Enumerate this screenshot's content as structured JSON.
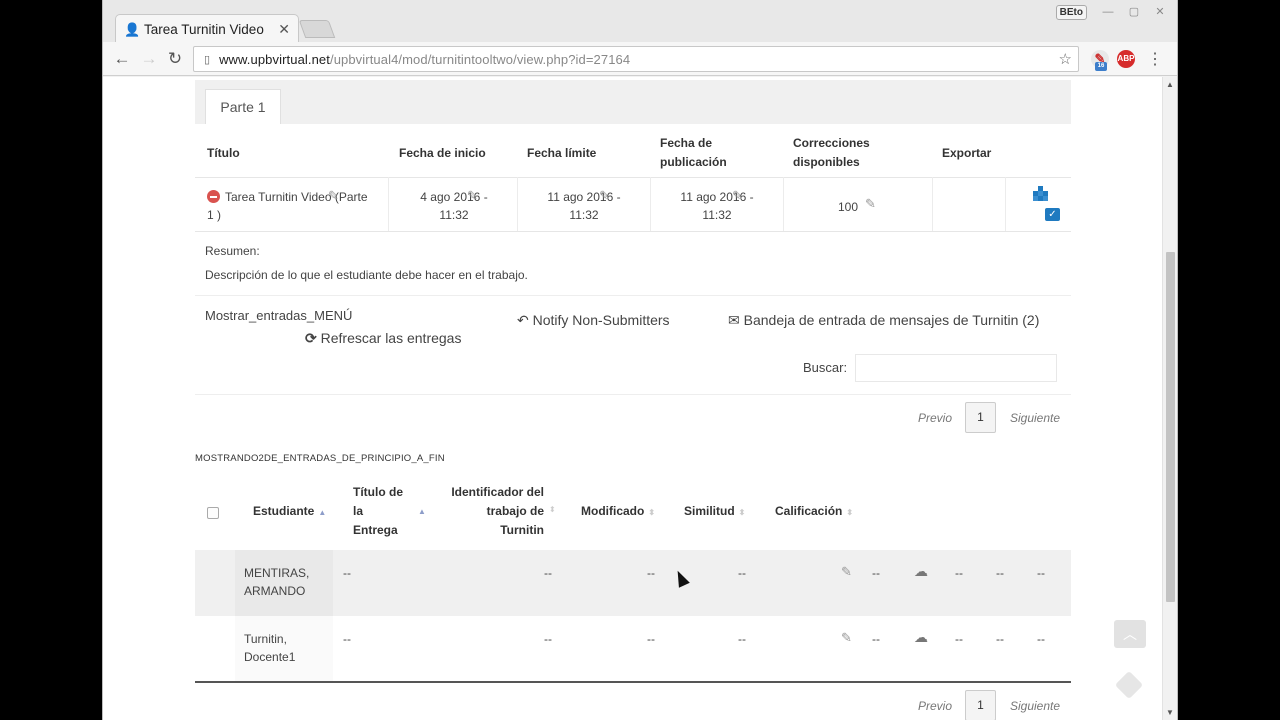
{
  "browser": {
    "tab_title": "Tarea Turnitin Video",
    "tab_close": "✕",
    "profile_badge": "BEto",
    "url_host": "www.upbvirtual.net",
    "url_path": "/upbvirtual4/mod/turnitintooltwo/view.php?id=27164",
    "ext_abp": "ABP",
    "ext_count": "16"
  },
  "parts": {
    "tab_label": "Parte 1"
  },
  "assignment": {
    "headers": {
      "title": "Título",
      "start": "Fecha de inicio",
      "due": "Fecha límite",
      "post_line1": "Fecha de",
      "post_line2": "publicación",
      "marks_line1": "Correcciones",
      "marks_line2": "disponibles",
      "export": "Exportar"
    },
    "row": {
      "title_line1": "Tarea Turnitin Video (Parte",
      "title_line2": "1      )",
      "start_line1": "4 ago 2016 -",
      "start_line2": "11:32",
      "due_line1": "11 ago 2016 -",
      "due_line2": "11:32",
      "post_line1": "11 ago 2016 -",
      "post_line2": "11:32",
      "marks": "100"
    },
    "summary_label": "Resumen:",
    "summary_text": "Descripción de lo que el estudiante debe hacer en el trabajo."
  },
  "controls": {
    "show_entries": "Mostrar_entradas_MENÚ",
    "refresh": "Refrescar las entregas",
    "notify": "Notify Non-Submitters",
    "inbox": "Bandeja de entrada de mensajes de Turnitin (2)",
    "search_label": "Buscar:"
  },
  "pagination": {
    "prev": "Previo",
    "page": "1",
    "next": "Siguiente"
  },
  "showing_text": "MOSTRANDO2DE_ENTRADAS_DE_PRINCIPIO_A_FIN",
  "submissions": {
    "headers": {
      "student": "Estudiante",
      "title_l1": "Título de",
      "title_l2": "la",
      "title_l3": "Entrega",
      "id_l1": "Identificador del",
      "id_l2": "trabajo de",
      "id_l3": "Turnitin",
      "modified": "Modificado",
      "similarity": "Similitud",
      "grade": "Calificación"
    },
    "rows": [
      {
        "name_l1": "MENTIRAS,",
        "name_l2": "ARMANDO",
        "title": "--",
        "paper_id": "--",
        "modified": "--",
        "similarity": "--",
        "grade": "--",
        "c1": "--",
        "c2": "--",
        "c3": "--"
      },
      {
        "name_l1": "Turnitin,",
        "name_l2": "Docente1",
        "title": "--",
        "paper_id": "--",
        "modified": "--",
        "similarity": "--",
        "grade": "--",
        "c1": "--",
        "c2": "--",
        "c3": "--"
      }
    ]
  },
  "colors": {
    "accent": "#1f7ac0",
    "danger": "#d9534f",
    "row_hover": "#f0f0f0"
  },
  "icons": [
    "user-icon",
    "back-icon",
    "forward-icon",
    "reload-icon",
    "star-icon",
    "pencil-icon",
    "stop-icon",
    "export-icon",
    "refresh-icon",
    "reply-icon",
    "envelope-icon",
    "cloud-upload-icon",
    "chevron-up-icon"
  ]
}
